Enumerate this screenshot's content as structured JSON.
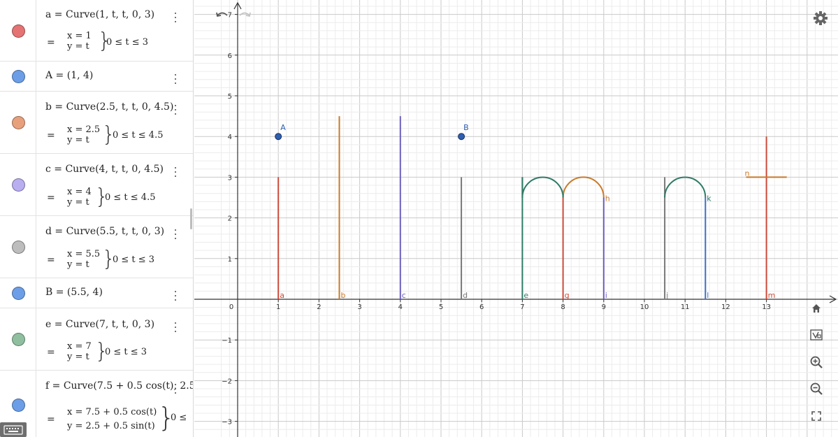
{
  "algebra": {
    "items": [
      {
        "name": "a",
        "definition": "a = Curve(1, t, t, 0, 3)",
        "equals": "=",
        "x_expr": "x = 1",
        "y_expr": "y = t",
        "range": "0 ≤ t ≤ 3",
        "color": "#e57373"
      },
      {
        "name": "A",
        "definition": "A = (1, 4)",
        "color": "#6c9ee8"
      },
      {
        "name": "b",
        "definition": "b = Curve(2.5, t, t, 0, 4.5)",
        "equals": "=",
        "x_expr": "x = 2.5",
        "y_expr": "y = t",
        "range": "0 ≤ t ≤ 4.5",
        "color": "#e8a07c"
      },
      {
        "name": "c",
        "definition": "c = Curve(4, t, t, 0, 4.5)",
        "equals": "=",
        "x_expr": "x = 4",
        "y_expr": "y = t",
        "range": "0 ≤ t ≤ 4.5",
        "color": "#b8aef0"
      },
      {
        "name": "d",
        "definition": "d = Curve(5.5, t, t, 0, 3)",
        "equals": "=",
        "x_expr": "x = 5.5",
        "y_expr": "y = t",
        "range": "0 ≤ t ≤ 3",
        "color": "#bdbdbd"
      },
      {
        "name": "B",
        "definition": "B = (5.5, 4)",
        "color": "#6c9ee8"
      },
      {
        "name": "e",
        "definition": "e = Curve(7, t, t, 0, 3)",
        "equals": "=",
        "x_expr": "x = 7",
        "y_expr": "y = t",
        "range": "0 ≤ t ≤ 3",
        "color": "#8fbf9f"
      },
      {
        "name": "f",
        "definition": "f = Curve(7.5 + 0.5 cos(t), 2.5 -",
        "equals": "=",
        "x_expr": "x = 7.5 + 0.5 cos(t)",
        "y_expr": "y = 2.5 + 0.5 sin(t)",
        "range": "0 ≤",
        "color": "#6c9ee8"
      }
    ]
  },
  "graphics": {
    "x_ticks": [
      "1",
      "2",
      "3",
      "4",
      "5",
      "6",
      "7",
      "8",
      "9",
      "10",
      "11",
      "12",
      "13"
    ],
    "y_ticks_pos": [
      "1",
      "2",
      "3",
      "4",
      "5",
      "6",
      "7"
    ],
    "y_ticks_neg": [
      "−1",
      "−2",
      "−3"
    ],
    "origin_label": "0",
    "grid": true,
    "colors": {
      "red": "#cc4a3a",
      "orange": "#c87a2a",
      "purple": "#6b5fc0",
      "gray": "#777777",
      "teal": "#2f7a66",
      "blue": "#3a6fc8",
      "point": "#2f5fb0"
    },
    "segments": [
      {
        "label": "a",
        "x": 1,
        "y0": 0,
        "y1": 3,
        "color": "#cc4a3a"
      },
      {
        "label": "b",
        "x": 2.5,
        "y0": 0,
        "y1": 4.5,
        "color": "#c87a2a"
      },
      {
        "label": "c",
        "x": 4,
        "y0": 0,
        "y1": 4.5,
        "color": "#6b5fc0"
      },
      {
        "label": "d",
        "x": 5.5,
        "y0": 0,
        "y1": 3,
        "color": "#777777"
      },
      {
        "label": "e",
        "x": 7,
        "y0": 0,
        "y1": 3,
        "color": "#2f7a66"
      },
      {
        "label": "g",
        "x": 8,
        "y0": 0,
        "y1": 2.5,
        "color": "#cc4a3a"
      },
      {
        "label": "i",
        "x": 9,
        "y0": 0,
        "y1": 2.5,
        "color": "#6b5fc0"
      },
      {
        "label": "j",
        "x": 10.5,
        "y0": 0,
        "y1": 3,
        "color": "#777777"
      },
      {
        "label": "l",
        "x": 11.5,
        "y0": 0,
        "y1": 2.5,
        "color": "#3a6fc8"
      },
      {
        "label": "m",
        "x": 13,
        "y0": 0,
        "y1": 4,
        "color": "#cc4a3a"
      }
    ],
    "arcs": [
      {
        "label": "",
        "cx": 7.5,
        "cy": 2.5,
        "r": 0.5,
        "color": "#2f7a66"
      },
      {
        "label": "h",
        "cx": 8.5,
        "cy": 2.5,
        "r": 0.5,
        "color": "#c87a2a"
      },
      {
        "label": "k",
        "cx": 11,
        "cy": 2.5,
        "r": 0.5,
        "color": "#2f7a66"
      }
    ],
    "extras": [
      {
        "label": "",
        "x0": 7,
        "x1": 7,
        "y0": 2.5,
        "y1": 3,
        "color": "#2f7a66"
      },
      {
        "label": "",
        "x0": 8,
        "x1": 8,
        "y0": 2.5,
        "y1": 2.6,
        "color": "#2f7a66"
      },
      {
        "label": "n",
        "x0": 12.5,
        "x1": 13.5,
        "y0": 3,
        "y1": 3,
        "color": "#c87a2a"
      }
    ],
    "points": [
      {
        "label": "A",
        "x": 1,
        "y": 4,
        "color": "#2f5fb0"
      },
      {
        "label": "B",
        "x": 5.5,
        "y": 4,
        "color": "#2f5fb0"
      }
    ]
  },
  "toolbar": {
    "icons": [
      "home-icon",
      "graphing-style-icon",
      "zoom-in-icon",
      "zoom-out-icon",
      "fullscreen-icon"
    ],
    "top": [
      "undo-icon",
      "redo-icon",
      "settings-gear-icon",
      "keyboard-icon"
    ]
  }
}
